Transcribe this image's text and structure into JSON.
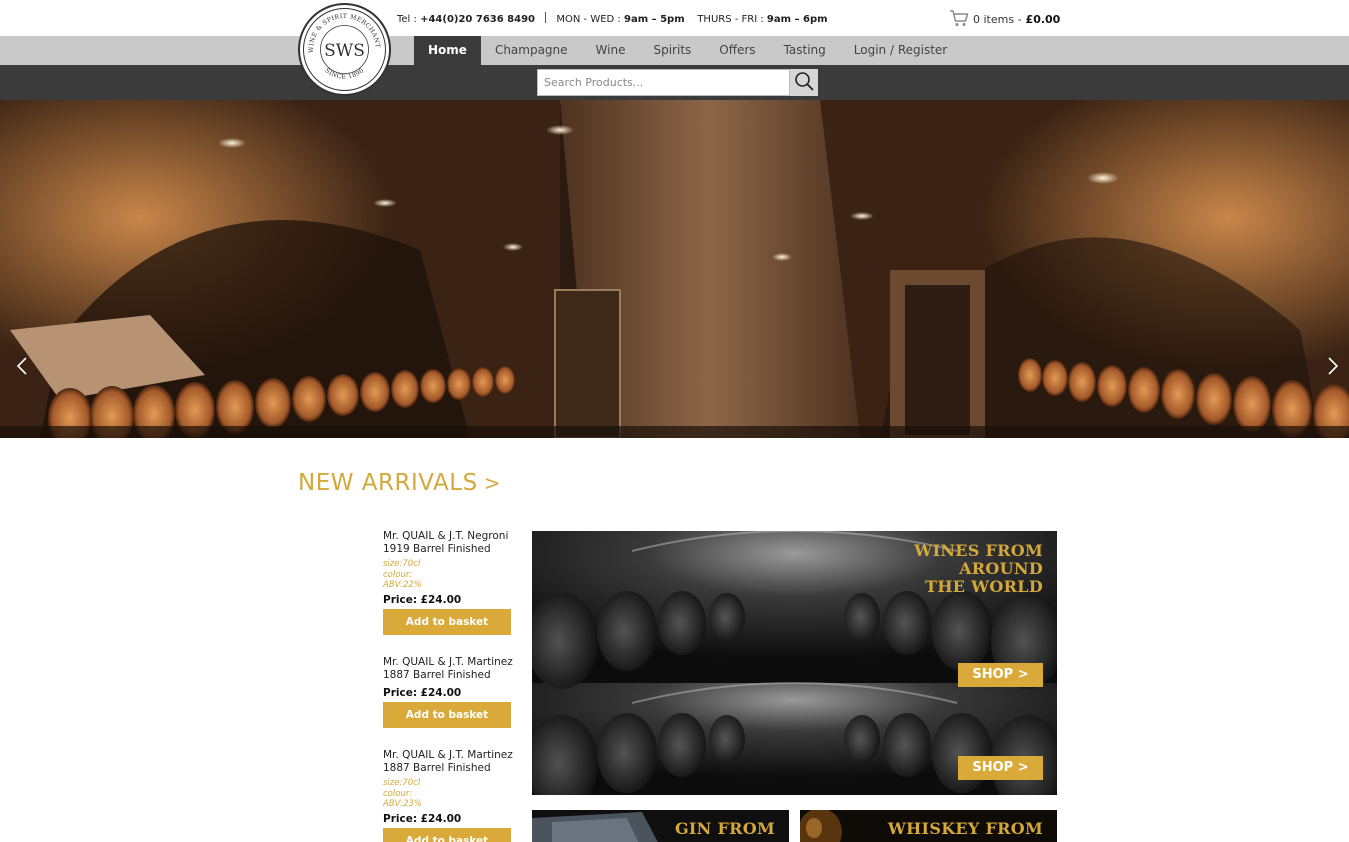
{
  "header": {
    "tel_label": "Tel :",
    "tel_number": "+44(0)20 7636 8490",
    "hours_mw_label": "MON - WED :",
    "hours_mw": "9am – 5pm",
    "hours_tf_label": "THURS - FRI :",
    "hours_tf": "9am – 6pm",
    "cart_items": "0 items -",
    "cart_total": "£0.00"
  },
  "logo": {
    "monogram": "SWS",
    "ring_text": "WINE & SPIRIT MERCHANTS",
    "since": "SINCE 1890"
  },
  "nav": {
    "items": [
      "Home",
      "Champagne",
      "Wine",
      "Spirits",
      "Offers",
      "Tasting",
      "Login / Register"
    ],
    "active": "Home"
  },
  "search": {
    "placeholder": "Search Products..."
  },
  "new_arrivals": {
    "title": "NEW ARRIVALS",
    "chevron": ">",
    "products": [
      {
        "name": "Mr. QUAIL & J.T. Negroni 1919 Barrel Finished",
        "size": "size:70cl",
        "colour": "colour:",
        "abv": "ABV:22%",
        "price": "Price: £24.00",
        "button": "Add to basket"
      },
      {
        "name": "Mr. QUAIL & J.T. Martinez 1887 Barrel Finished",
        "price": "Price: £24.00",
        "button": "Add to basket"
      },
      {
        "name": "Mr. QUAIL & J.T. Martinez 1887 Barrel Finished",
        "size": "size:70cl",
        "colour": "colour:",
        "abv": "ABV:23%",
        "price": "Price: £24.00",
        "button": "Add to basket"
      }
    ]
  },
  "banners": {
    "wines_line1": "WINES FROM",
    "wines_line2": "AROUND",
    "wines_line3": "THE WORLD",
    "shop_label": "SHOP >",
    "gin_line1": "GIN FROM",
    "whiskey_line1": "WHISKEY FROM"
  },
  "colors": {
    "gold": "#d4a83a",
    "nav_dark": "#3b3b3b",
    "nav_light": "#c9c9c9"
  }
}
